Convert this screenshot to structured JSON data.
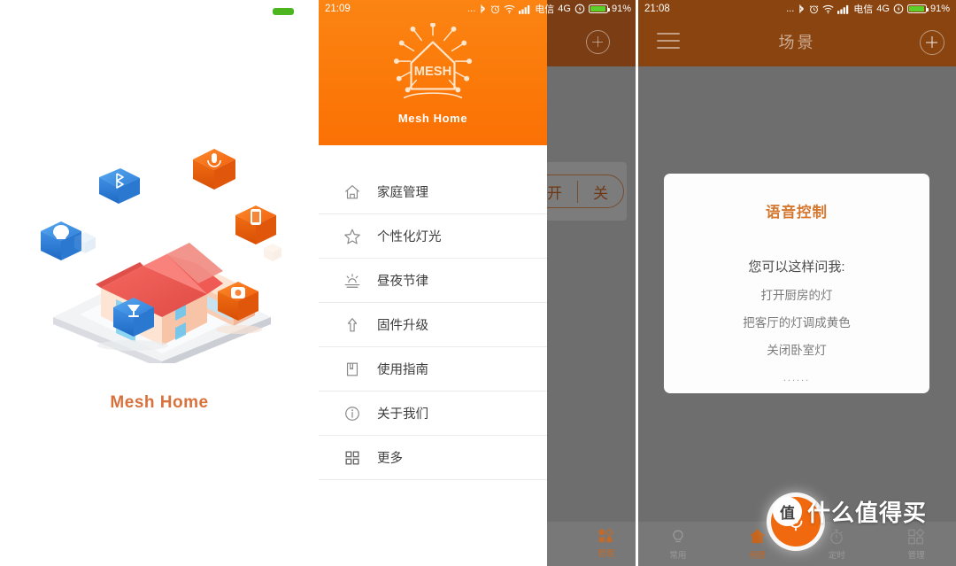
{
  "splash": {
    "app_name": "Mesh Home",
    "battery_pill_color": "#4cb520",
    "title_color": "#d9713c",
    "art": {
      "name": "isometric-smart-home-illustration",
      "cards": [
        {
          "icon": "bluetooth-icon",
          "color": "#3b8fe0"
        },
        {
          "icon": "microphone-icon",
          "color": "#f47216"
        },
        {
          "icon": "bulb-icon",
          "color": "#3b8fe0"
        },
        {
          "icon": "smartphone-icon",
          "color": "#f47216"
        },
        {
          "icon": "desk-lamp-icon",
          "color": "#3b8fe0"
        },
        {
          "icon": "speaker-icon",
          "color": "#f47216"
        }
      ]
    }
  },
  "statusbar": {
    "time_drawer": "21:09",
    "time_scene": "21:08",
    "dots": "...",
    "bluetooth": "✻",
    "alarm": "⏰",
    "wifi": "wifi-icon",
    "signal": "signal-icon",
    "carrier": "电信",
    "network": "4G",
    "vibrate": "vibrate-icon",
    "battery_percent": "91%"
  },
  "drawer": {
    "logo_text": "MESH",
    "logo_name": "Mesh Home",
    "header_color": "#fb7a09",
    "items": [
      {
        "label": "家庭管理",
        "icon": "home-icon"
      },
      {
        "label": "个性化灯光",
        "icon": "star-icon"
      },
      {
        "label": "昼夜节律",
        "icon": "sunrise-icon"
      },
      {
        "label": "固件升级",
        "icon": "upload-arrow-icon"
      },
      {
        "label": "使用指南",
        "icon": "book-icon"
      },
      {
        "label": "关于我们",
        "icon": "info-circle-icon"
      },
      {
        "label": "更多",
        "icon": "grid-icon"
      }
    ]
  },
  "underlying": {
    "toggle_on": "开",
    "toggle_off": "关",
    "tab": {
      "label": "管理",
      "icon": "grid-icon"
    }
  },
  "scene": {
    "title": "场景",
    "menu_icon": "hamburger-icon",
    "add_icon": "plus-circle-icon",
    "dialog": {
      "title": "语音控制",
      "subtitle": "您可以这样问我:",
      "examples": [
        "打开厨房的灯",
        "把客厅的灯调成黄色",
        "关闭卧室灯"
      ],
      "ellipsis": "......",
      "title_color": "#d4772f"
    },
    "tabs": [
      {
        "label": "常用",
        "icon": "bulb-icon",
        "active": false
      },
      {
        "label": "场景",
        "icon": "home-icon",
        "active": true
      },
      {
        "label": "定时",
        "icon": "timer-icon",
        "active": false
      },
      {
        "label": "管理",
        "icon": "grid-icon",
        "active": false
      }
    ],
    "mic_fab": {
      "icon": "microphone-icon",
      "color": "#f1690f"
    }
  },
  "watermark": {
    "badge": "值",
    "text": "什么值得买"
  }
}
